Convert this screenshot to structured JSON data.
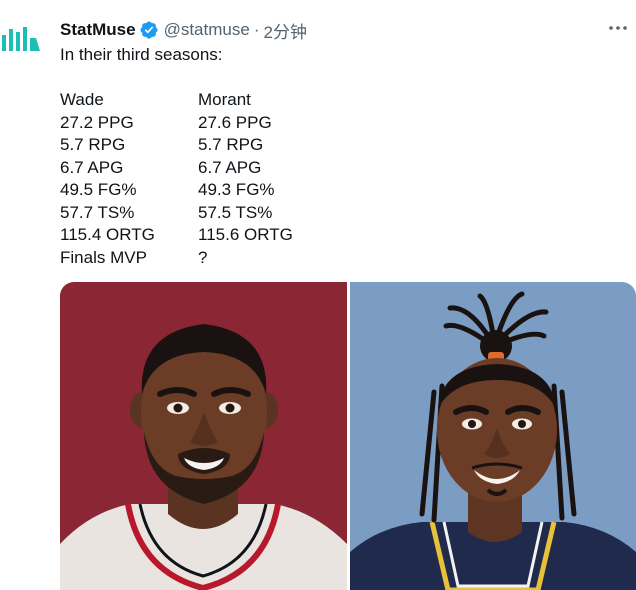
{
  "tweet": {
    "author_name": "StatMuse",
    "handle": "@statmuse",
    "separator": "·",
    "time": "2分钟",
    "intro": "In their third seasons:",
    "rows": [
      {
        "a": "Wade",
        "b": "Morant"
      },
      {
        "a": "27.2 PPG",
        "b": "27.6 PPG"
      },
      {
        "a": "5.7 RPG",
        "b": "5.7 RPG"
      },
      {
        "a": "6.7 APG",
        "b": "6.7 APG"
      },
      {
        "a": "49.5 FG%",
        "b": "49.3 FG%"
      },
      {
        "a": "57.7 TS%",
        "b": "57.5 TS%"
      },
      {
        "a": "115.4 ORTG",
        "b": "115.6 ORTG"
      },
      {
        "a": "Finals MVP",
        "b": "?"
      }
    ]
  },
  "icons": {
    "avatar": "statmuse-logo-icon",
    "verified": "verified-badge-icon",
    "more": "more-options-icon"
  },
  "colors": {
    "wade_bg": "#8b2734",
    "morant_bg": "#7c9dc3",
    "verified": "#1d9bf0",
    "logo": "#1dbfb5"
  }
}
